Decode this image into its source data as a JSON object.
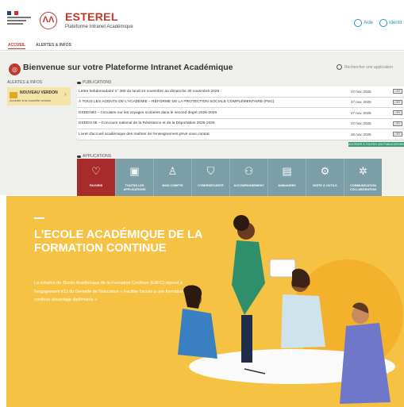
{
  "header": {
    "brand_title": "ESTEREL",
    "brand_subtitle": "Plateforme Intranet Académique",
    "logo_letters": "ΛΛ",
    "help_label": "Aide",
    "identity_label": "Identit",
    "icons": [
      "marianne-logo",
      "esterel-logo",
      "help-icon",
      "identity-icon"
    ]
  },
  "nav": {
    "tabs": [
      {
        "label": "ACCUEIL",
        "active": true
      },
      {
        "label": "ALERTES & INFOS",
        "active": false
      }
    ]
  },
  "welcome": {
    "title": "Bienvenue sur votre Plateforme Intranet Académique",
    "search_placeholder": "Rechercher une application"
  },
  "alerts": {
    "section_label": "ALERTES & INFOS",
    "card_title": "NOUVEAU VERDON",
    "card_subtitle": "Accéder à la nouvelle version"
  },
  "publications": {
    "section_label": "PUBLICATIONS",
    "items": [
      {
        "title": "Lettre hebdomadaire n° 380 du lundi 24 novembre au dimanche 30 novembre 2025",
        "date": "27 nov. 2025",
        "tag": "LIRE"
      },
      {
        "title": "À TOUS LES AGENTS DE L'ACADÉMIE – RÉFORME DE LA PROTECTION SOCIALE COMPLÉMENTAIRE (PSC)",
        "date": "27 nov. 2025",
        "tag": "LIRE"
      },
      {
        "title": "DSDEN83 – Circulaire sur les voyages scolaires dans le second degré 2025-2026",
        "date": "27 nov. 2025",
        "tag": "LIRE"
      },
      {
        "title": "DSDEN 06 – Concours national de la Résistance et de la Déportation 2025-2026",
        "date": "27 nov. 2025",
        "tag": "LIRE"
      },
      {
        "title": "Livret d'accueil académique des maîtres de l'enseignement privé sous contrat",
        "date": "26 nov. 2025",
        "tag": "LIRE"
      }
    ],
    "all_button": "ACCÉDER À TOUTES LES PUBLICATIONS"
  },
  "applications": {
    "section_label": "APPLICATIONS",
    "tiles": [
      {
        "label": "FAVORIS",
        "icon": "heart-icon",
        "glyph": "♡",
        "color": "#a82b2b"
      },
      {
        "label": "TOUTES LES APPLICATIONS",
        "icon": "apps-icon",
        "glyph": "▣",
        "color": "#7b9ea8"
      },
      {
        "label": "MON COMPTE",
        "icon": "user-icon",
        "glyph": "♙",
        "color": "#7b9ea8"
      },
      {
        "label": "CYBERSÉCURITÉ",
        "icon": "shield-icon",
        "glyph": "⛉",
        "color": "#7b9ea8"
      },
      {
        "label": "ACCOMPAGNEMENT",
        "icon": "people-icon",
        "glyph": "⚇",
        "color": "#7b9ea8"
      },
      {
        "label": "ANNUAIRES",
        "icon": "book-icon",
        "glyph": "▤",
        "color": "#7b9ea8"
      },
      {
        "label": "BOÎTE À OUTILS",
        "icon": "tools-icon",
        "glyph": "⚙",
        "color": "#7b9ea8"
      },
      {
        "label": "COMMUNICATION COLLABORATION",
        "icon": "network-icon",
        "glyph": "✲",
        "color": "#7b9ea8"
      }
    ]
  },
  "hero": {
    "title": "L'ECOLE ACADÉMIQUE DE LA FORMATION CONTINUE",
    "text": "La création de l'Ecole Académique de la Formation Continue (EAFC) répond à l'engagement #12 du Grenelle de l'éducation « Faciliter l'accès à une formation continue davantage diplômante »",
    "background": "#f6c243"
  },
  "colors": {
    "brand_red": "#c0392b",
    "link_blue": "#2a8fb8",
    "tile_gray": "#7b9ea8",
    "green_button": "#3a9b7a"
  }
}
